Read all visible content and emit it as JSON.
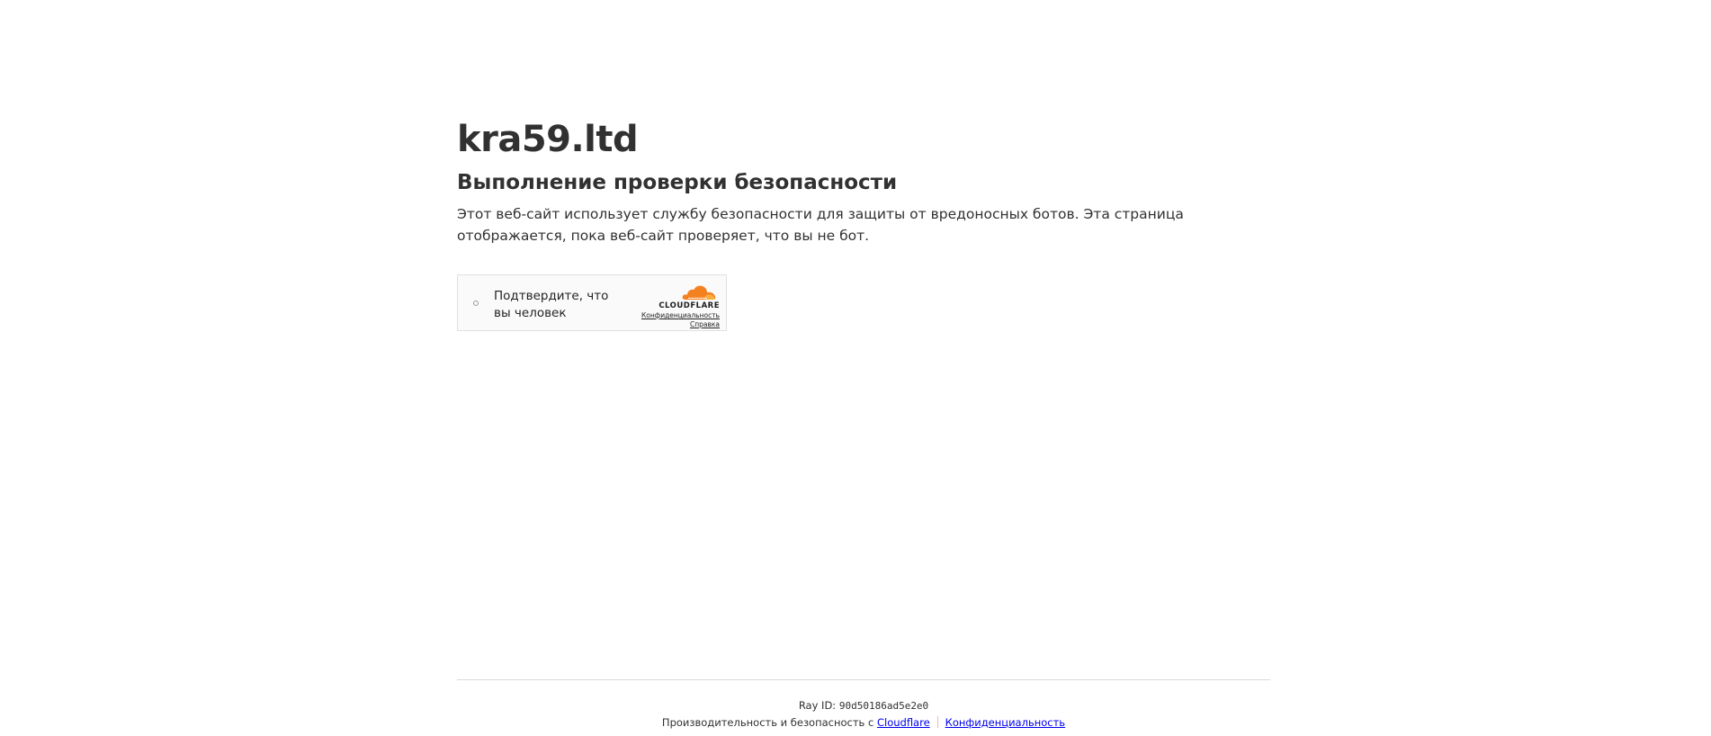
{
  "site": {
    "domain": "kra59.ltd",
    "heading": "Выполнение проверки безопасности",
    "description": "Этот веб-сайт использует службу безопасности для защиты от вредоносных ботов. Эта страница отображается, пока веб-сайт проверяет, что вы не бот."
  },
  "challenge": {
    "checkbox_label": "Подтвердите, что вы человек",
    "brand_logo_icon": "cloudflare-cloud-icon",
    "brand_name": "CLOUDFLARE",
    "privacy_link": "Конфиденциальность",
    "help_link": "Справка",
    "accent_color": "#f48120"
  },
  "footer": {
    "ray_label": "Ray ID:",
    "ray_id": "90d50186ad5e2e0",
    "performance_text": "Производительность и безопасность с",
    "cloudflare_link": "Cloudflare",
    "privacy_link": "Конфиденциальность",
    "link_color": "#0000ee"
  }
}
